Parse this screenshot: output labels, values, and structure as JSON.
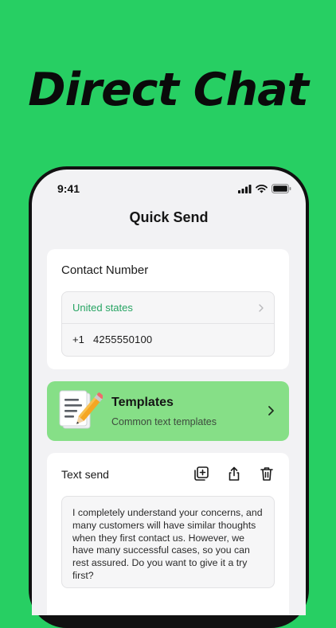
{
  "headline": "Direct Chat",
  "status": {
    "time": "9:41"
  },
  "screen_title": "Quick Send",
  "contact": {
    "title": "Contact Number",
    "country": "United states",
    "dial_code": "+1",
    "number": "4255550100"
  },
  "templates": {
    "title": "Templates",
    "subtitle": "Common text templates"
  },
  "text_send": {
    "title": "Text send",
    "message": "I completely understand your concerns, and many customers will have similar thoughts when they first contact us. However, we have many successful cases, so you can rest assured. Do you want to give it a try first?"
  },
  "colors": {
    "background": "#27cf63",
    "accent_text": "#27a463",
    "templates_card": "#86df87"
  }
}
